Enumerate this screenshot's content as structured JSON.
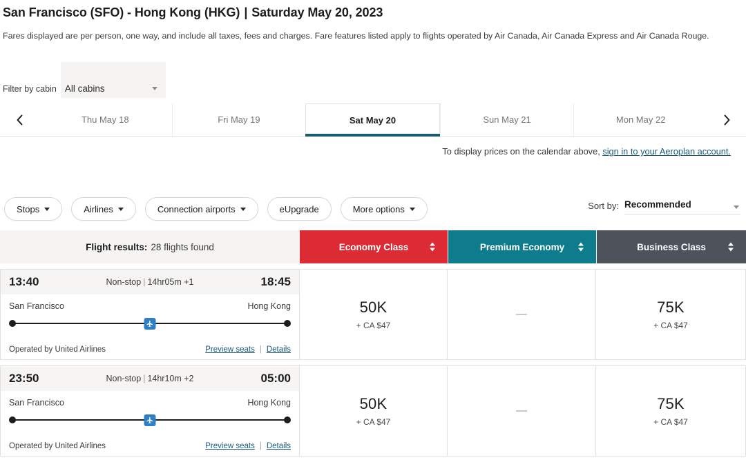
{
  "header": {
    "origin": "San Francisco (SFO)",
    "dash": " - ",
    "destination": "Hong Kong (HKG)",
    "separator": "|",
    "date": "Saturday May 20, 2023",
    "title_full": "San Francisco (SFO) - Hong Kong (HKG)  |  Saturday May 20, 2023",
    "fare_note": "Fares displayed are per person, one way, and include all taxes, fees and charges. Fare features listed apply to flights operated by Air Canada, Air Canada Express and Air Canada Rouge."
  },
  "cabin_filter": {
    "label": "Filter by cabin",
    "value": "All cabins",
    "caret_icon": "chevron-down-icon"
  },
  "date_nav": {
    "prev_icon": "chevron-left-icon",
    "next_icon": "chevron-right-icon",
    "tabs": [
      {
        "label": "Thu May 18",
        "active": false
      },
      {
        "label": "Fri May 19",
        "active": false
      },
      {
        "label": "Sat May 20",
        "active": true
      },
      {
        "label": "Sun May 21",
        "active": false
      },
      {
        "label": "Mon May 22",
        "active": false
      }
    ]
  },
  "signin_note": {
    "text": "To display prices on the calendar above, ",
    "link": "sign in to your Aeroplan account."
  },
  "filters": {
    "pills": [
      {
        "label": "Stops",
        "has_caret": true
      },
      {
        "label": "Airlines",
        "has_caret": true
      },
      {
        "label": "Connection airports",
        "has_caret": true
      },
      {
        "label": "eUpgrade",
        "has_caret": false
      },
      {
        "label": "More options",
        "has_caret": true
      }
    ]
  },
  "sort": {
    "label": "Sort by:",
    "value": "Recommended",
    "caret_icon": "chevron-down-icon"
  },
  "results": {
    "label": "Flight results:",
    "count_text": "28 flights found",
    "columns": [
      {
        "name": "Economy Class",
        "color": "#dc2b35"
      },
      {
        "name": "Premium Economy",
        "color": "#0e7c8c"
      },
      {
        "name": "Business Class",
        "color": "#4d525b"
      }
    ]
  },
  "flights": [
    {
      "depart_time": "13:40",
      "arrive_time": "18:45",
      "stops": "Non-stop",
      "duration": "14hr05m +1",
      "origin_city": "San Francisco",
      "destination_city": "Hong Kong",
      "operator": "Operated by United Airlines",
      "preview_seats": "Preview seats",
      "details": "Details",
      "prices": {
        "economy": {
          "points": "50K",
          "cash": "+ CA $47",
          "available": true
        },
        "premium": {
          "points": "—",
          "cash": "",
          "available": false
        },
        "business": {
          "points": "75K",
          "cash": "+ CA $47",
          "available": true
        }
      }
    },
    {
      "depart_time": "23:50",
      "arrive_time": "05:00",
      "stops": "Non-stop",
      "duration": "14hr10m +2",
      "origin_city": "San Francisco",
      "destination_city": "Hong Kong",
      "operator": "Operated by United Airlines",
      "preview_seats": "Preview seats",
      "details": "Details",
      "prices": {
        "economy": {
          "points": "50K",
          "cash": "+ CA $47",
          "available": true
        },
        "premium": {
          "points": "—",
          "cash": "",
          "available": false
        },
        "business": {
          "points": "75K",
          "cash": "+ CA $47",
          "available": true
        }
      }
    }
  ]
}
